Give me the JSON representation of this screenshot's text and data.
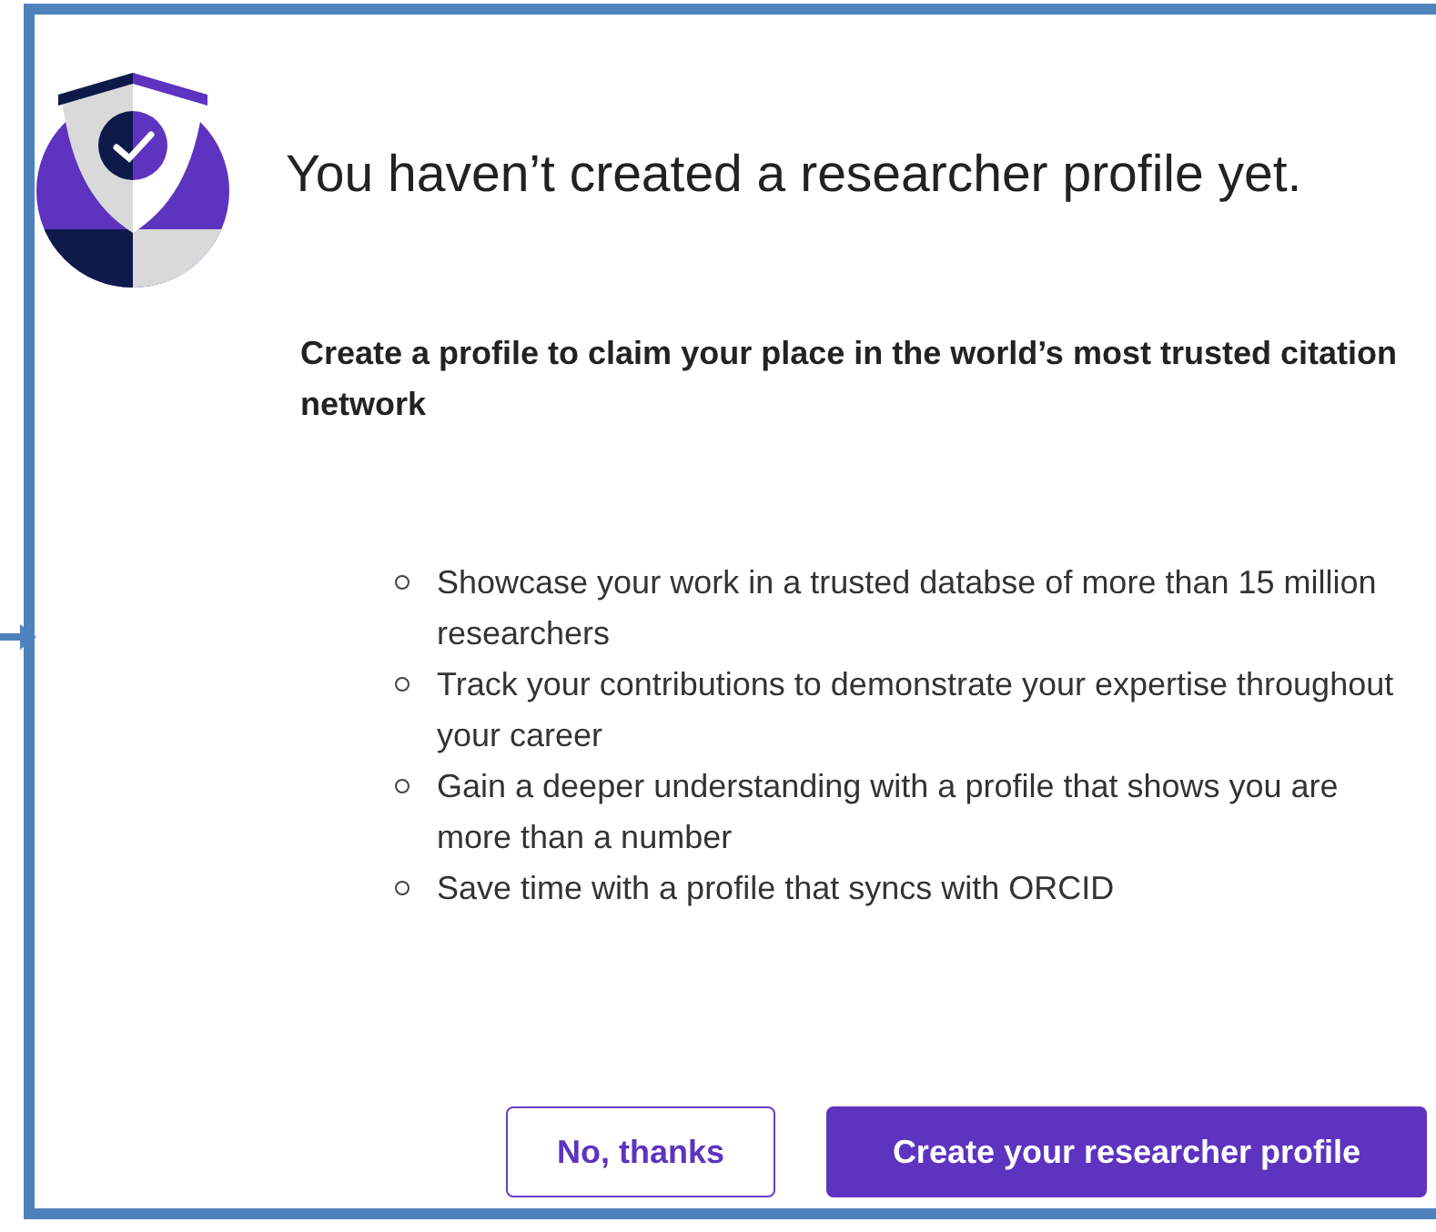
{
  "dialog": {
    "title": "You haven’t created a researcher profile yet.",
    "subtitle": "Create a profile to claim your place in the world’s most trusted citation network",
    "benefits": [
      "Showcase your work in a trusted databse of more than 15 million researchers",
      "Track your contributions to demonstrate your expertise throughout your career",
      "Gain a deeper understanding with a profile that shows you are more than a number",
      "Save time with a profile that syncs with ORCID"
    ],
    "buttons": [
      {
        "label": "No, thanks",
        "kind": "secondary"
      },
      {
        "label": "Create your researcher profile",
        "kind": "primary"
      }
    ]
  }
}
